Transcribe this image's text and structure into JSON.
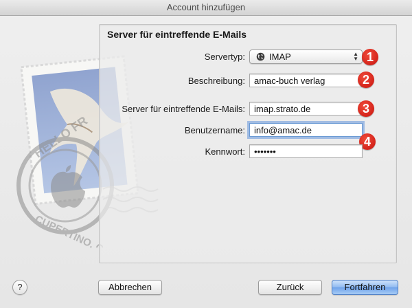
{
  "window": {
    "title": "Account hinzufügen"
  },
  "section": {
    "title": "Server für eintreffende E-Mails"
  },
  "form": {
    "servertype_label": "Servertyp:",
    "servertype_value": "IMAP",
    "description_label": "Beschreibung:",
    "description_value": "amac-buch verlag",
    "server_label": "Server für eintreffende E-Mails:",
    "server_value": "imap.strato.de",
    "username_label": "Benutzername:",
    "username_value": "info@amac.de",
    "password_label": "Kennwort:",
    "password_value": "•••••••"
  },
  "badges": [
    "1",
    "2",
    "3",
    "4"
  ],
  "buttons": {
    "help": "?",
    "cancel": "Abbrechen",
    "back": "Zurück",
    "continue": "Fortfahren"
  },
  "stamp": {
    "text_top": "HELLO FR",
    "text_bottom": "CUPERTINO, CA"
  },
  "colors": {
    "badge": "#d81e14",
    "default_button": "#8fbaf0",
    "focus_ring": "#6c9bd5"
  }
}
